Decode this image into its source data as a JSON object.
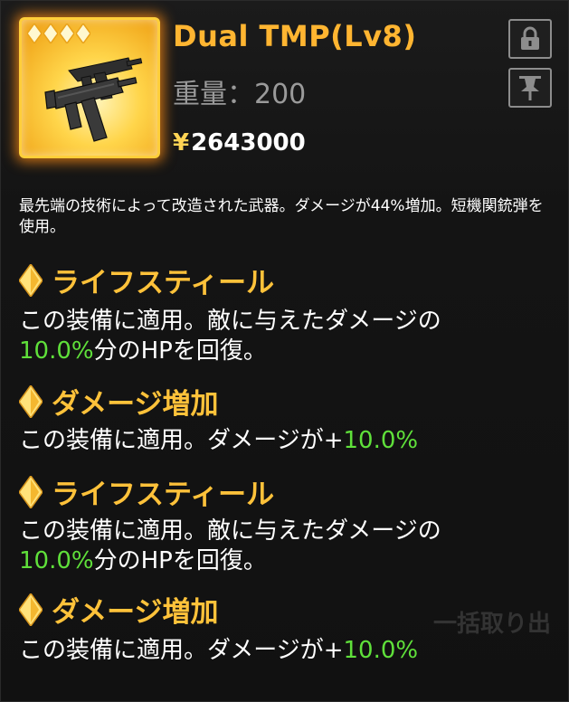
{
  "item": {
    "title": "Dual TMP(Lv8)",
    "weight": "重量：200",
    "price_symbol": "¥",
    "price": "2643000",
    "stars": 4,
    "weapon_icon": "dual-smg-icon",
    "description": "最先端の技術によって改造された武器。ダメージが44%増加。短機関銃弾を使用。"
  },
  "buttons": {
    "lock_icon": "lock-icon",
    "pin_icon": "pin-icon"
  },
  "background_text": {
    "line1": "ー 一括取り出",
    "line2": "一括取り出"
  },
  "skills": [
    {
      "name": "ライフスティール",
      "text_before": "この装備に適用。敵に与えたダメージの",
      "value": "10.0%",
      "text_after": "分のHPを回復。"
    },
    {
      "name": "ダメージ増加",
      "text_before": "この装備に適用。ダメージが+",
      "value": "10.0%",
      "text_after": ""
    },
    {
      "name": "ライフスティール",
      "text_before": "この装備に適用。敵に与えたダメージの",
      "value": "10.0%",
      "text_after": "分のHPを回復。"
    },
    {
      "name": "ダメージ増加",
      "text_before": "この装備に適用。ダメージが+",
      "value": "10.0%",
      "text_after": ""
    }
  ],
  "colors": {
    "title": "#ffb531",
    "skill": "#ffc23a",
    "value": "#5fe03a",
    "frame": "#ffcf3a"
  }
}
